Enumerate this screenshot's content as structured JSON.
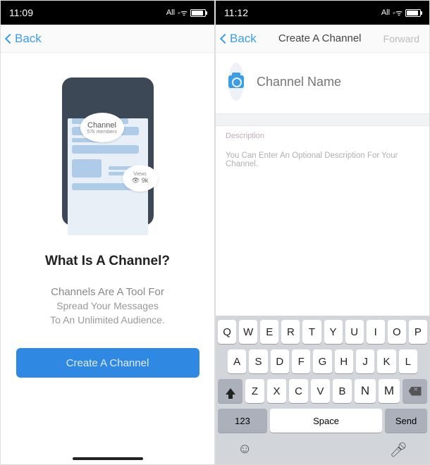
{
  "screen1": {
    "status_time": "11:09",
    "status_network": "All",
    "back_label": "Back",
    "phone_bubble_title": "Channel",
    "phone_bubble_members": "57k members",
    "views_label": "Views",
    "views_count": "👁 9k",
    "title": "What Is A Channel?",
    "sub_line1": "Channels Are A Tool For",
    "sub_line2": "Spread Your Messages",
    "sub_line3": "To An Unlimited Audience.",
    "cta_label": "Create A Channel"
  },
  "screen2": {
    "status_time": "11:12",
    "status_network": "All",
    "back_label": "Back",
    "nav_title": "Create A Channel",
    "nav_forward": "Forward",
    "name_placeholder": "Channel Name",
    "desc_label": "Description",
    "desc_placeholder": "You Can Enter An Optional Description For Your Channel."
  },
  "keyboard": {
    "row1": [
      "Q",
      "W",
      "E",
      "R",
      "T",
      "Y",
      "U",
      "I",
      "O",
      "P"
    ],
    "row2": [
      "A",
      "S",
      "D",
      "F",
      "G",
      "H",
      "J",
      "K",
      "L"
    ],
    "row3": [
      "Z",
      "X",
      "C",
      "V",
      "B",
      "N",
      "M"
    ],
    "num_key": "123",
    "space_key": "Space",
    "send_key": "Send"
  }
}
